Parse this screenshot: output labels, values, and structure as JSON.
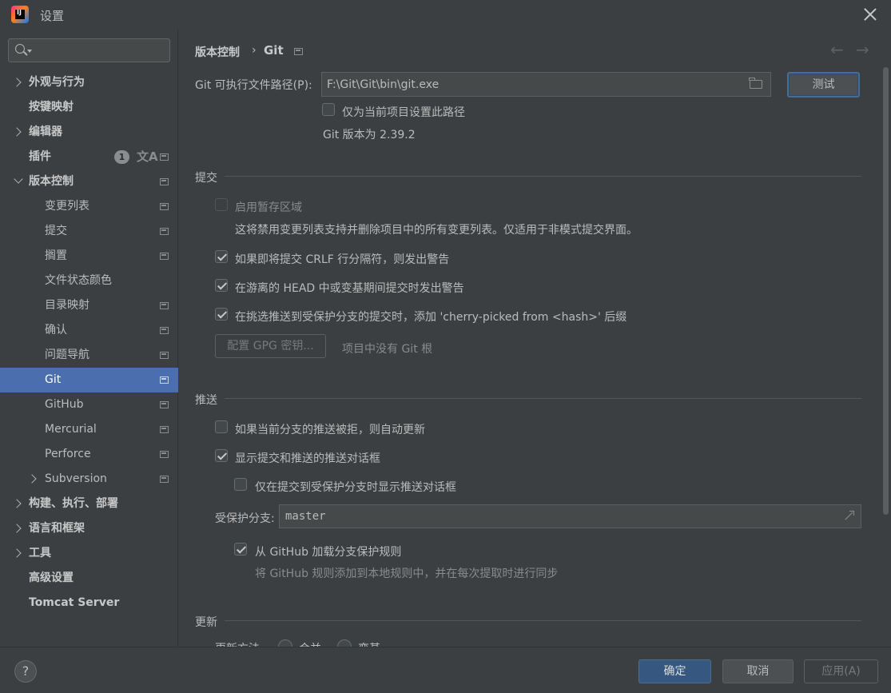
{
  "window": {
    "title": "设置"
  },
  "search": {
    "placeholder": ""
  },
  "sidebar": {
    "items": [
      {
        "label": "外观与行为"
      },
      {
        "label": "按键映射"
      },
      {
        "label": "编辑器"
      },
      {
        "label": "插件",
        "badge": "1"
      },
      {
        "label": "版本控制"
      },
      {
        "label": "变更列表"
      },
      {
        "label": "提交"
      },
      {
        "label": "搁置"
      },
      {
        "label": "文件状态颜色"
      },
      {
        "label": "目录映射"
      },
      {
        "label": "确认"
      },
      {
        "label": "问题导航"
      },
      {
        "label": "Git"
      },
      {
        "label": "GitHub"
      },
      {
        "label": "Mercurial"
      },
      {
        "label": "Perforce"
      },
      {
        "label": "Subversion"
      },
      {
        "label": "构建、执行、部署"
      },
      {
        "label": "语言和框架"
      },
      {
        "label": "工具"
      },
      {
        "label": "高级设置"
      },
      {
        "label": "Tomcat Server"
      }
    ],
    "translate_icon": "文A"
  },
  "breadcrumb": {
    "parent": "版本控制",
    "separator": "›",
    "current": "Git"
  },
  "nav": {
    "back": "←",
    "forward": "→"
  },
  "git_path": {
    "label": "Git 可执行文件路径(P):",
    "value": "F:\\Git\\Git\\bin\\git.exe",
    "test_button": "测试",
    "project_only_label": "仅为当前项目设置此路径",
    "version_text": "Git 版本为 2.39.2"
  },
  "commit": {
    "title": "提交",
    "staging_label": "启用暂存区域",
    "staging_desc": "这将禁用变更列表支持并删除项目中的所有变更列表。仅适用于非模式提交界面。",
    "crlf_label": "如果即将提交 CRLF 行分隔符，则发出警告",
    "detached_label": "在游离的 HEAD 中或变基期间提交时发出警告",
    "cherry_label": "在挑选推送到受保护分支的提交时，添加 'cherry-picked from <hash>' 后缀",
    "gpg_button": "配置 GPG 密钥...",
    "no_git_root": "项目中没有 Git 根"
  },
  "push": {
    "title": "推送",
    "auto_update_label": "如果当前分支的推送被拒，则自动更新",
    "show_dialog_label": "显示提交和推送的推送对话框",
    "protected_only_label": "仅在提交到受保护分支时显示推送对话框",
    "protected_branches_label": "受保护分支:",
    "protected_branches_value": "master",
    "github_rules_label": "从 GitHub 加载分支保护规则",
    "github_rules_desc": "将 GitHub 规则添加到本地规则中，并在每次提取时进行同步"
  },
  "update": {
    "title": "更新",
    "method_label": "更新方法",
    "merge": "合并",
    "rebase": "变基"
  },
  "footer": {
    "help": "?",
    "ok": "确定",
    "cancel": "取消",
    "apply": "应用(A)"
  }
}
